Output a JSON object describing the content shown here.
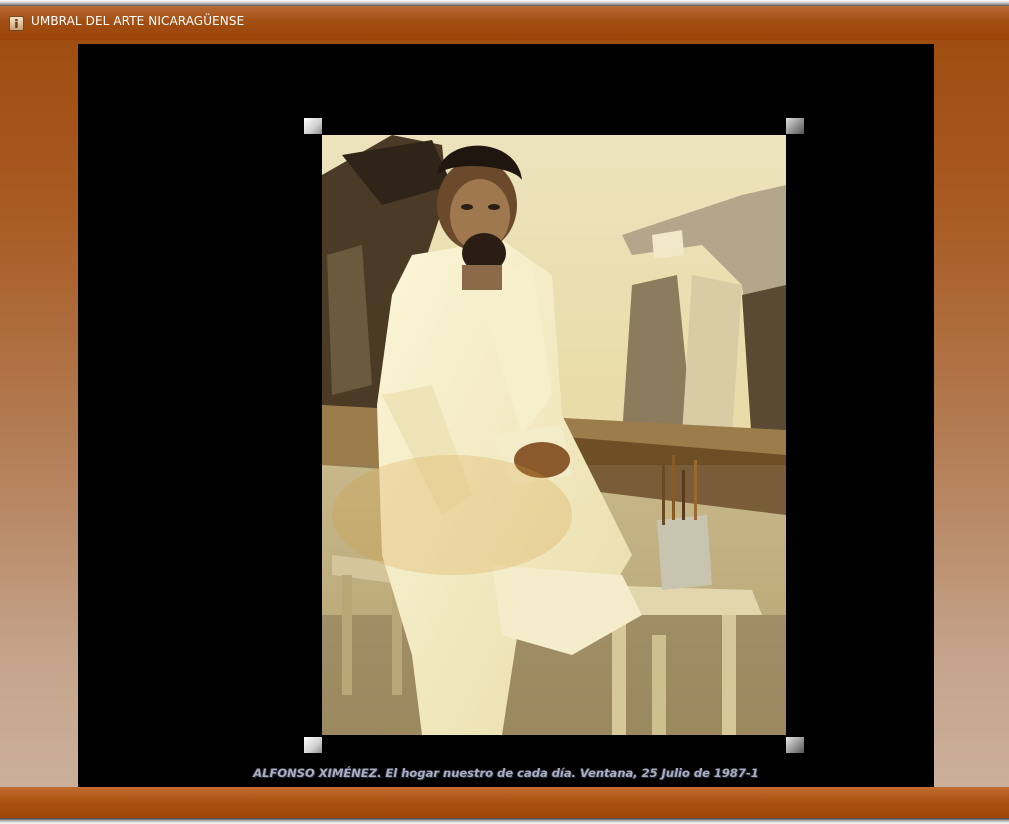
{
  "window": {
    "title": "UMBRAL DEL ARTE NICARAGÜENSE",
    "icon": "info-icon"
  },
  "viewer": {
    "caption": "ALFONSO XIMÉNEZ. El hogar nuestro de cada día. Ventana, 25 Julio de 1987-1",
    "image": "sepia photograph of bearded man in white clothes seated on a stool in an artist studio, brushes in a can on a wooden stool"
  },
  "colors": {
    "titlebar": "#9e4a0d",
    "viewer_bg": "#000000",
    "caption": "#a9aec2"
  }
}
